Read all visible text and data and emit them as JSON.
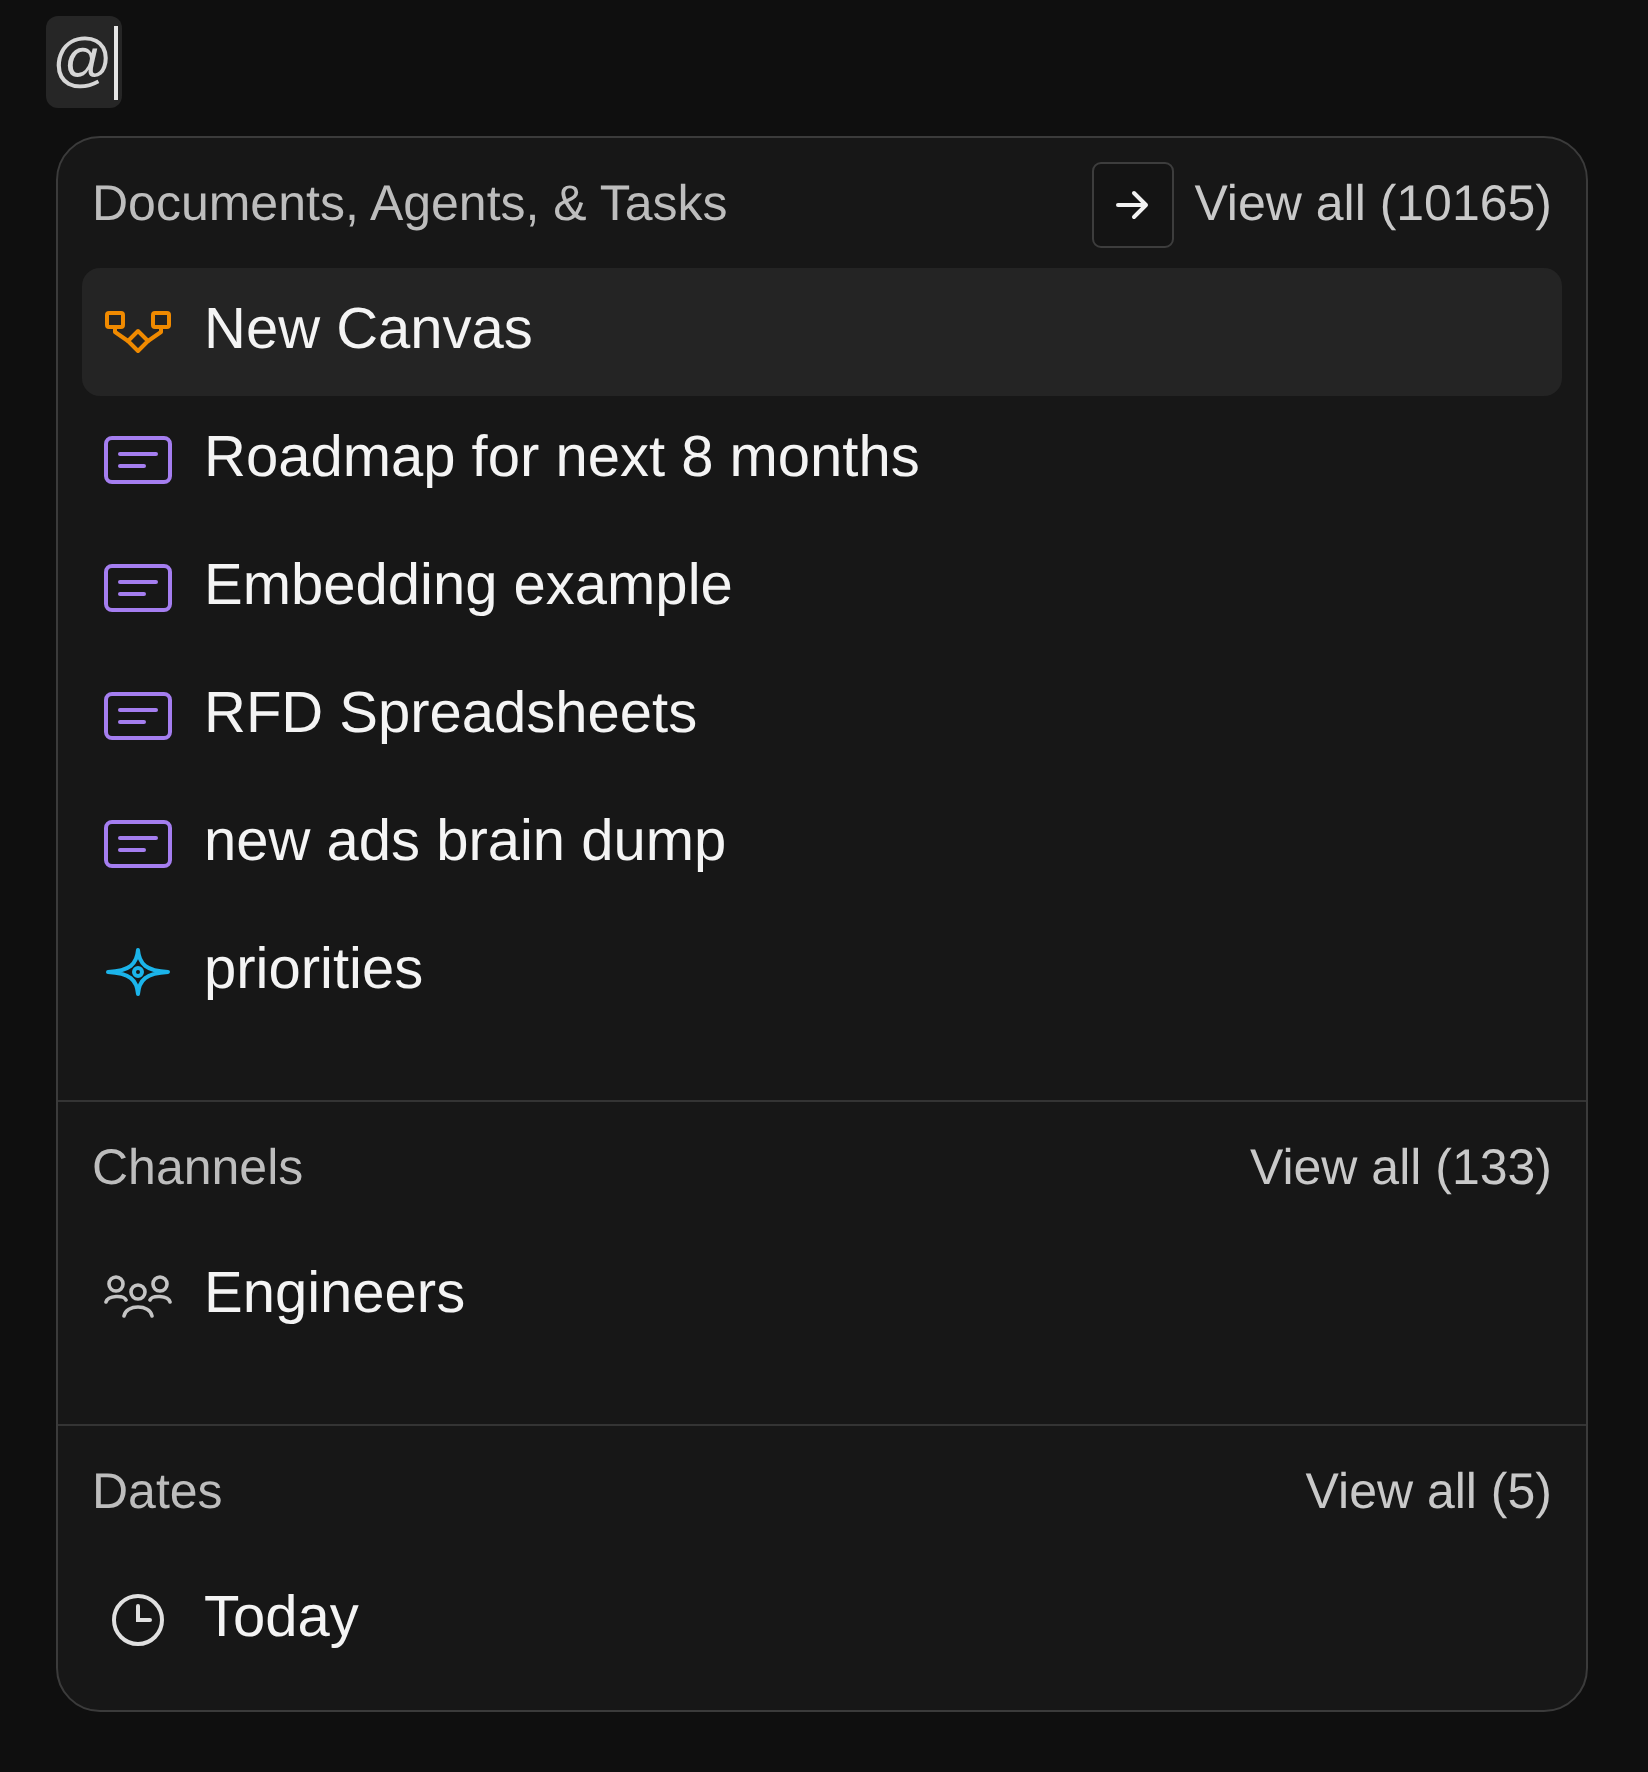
{
  "input": {
    "value": "@"
  },
  "sections": [
    {
      "title": "Documents, Agents, & Tasks",
      "view_all": "View all (10165)",
      "shortcut_hint": true,
      "items": [
        {
          "label": "New Canvas",
          "kind": "canvas",
          "selected": true
        },
        {
          "label": "Roadmap for next 8 months",
          "kind": "document",
          "selected": false
        },
        {
          "label": "Embedding example",
          "kind": "document",
          "selected": false
        },
        {
          "label": "RFD Spreadsheets",
          "kind": "document",
          "selected": false
        },
        {
          "label": "new ads brain dump",
          "kind": "document",
          "selected": false
        },
        {
          "label": "priorities",
          "kind": "agent",
          "selected": false
        }
      ]
    },
    {
      "title": "Channels",
      "view_all": "View all (133)",
      "shortcut_hint": false,
      "items": [
        {
          "label": "Engineers",
          "kind": "channel",
          "selected": false
        }
      ]
    },
    {
      "title": "Dates",
      "view_all": "View all (5)",
      "shortcut_hint": false,
      "items": [
        {
          "label": "Today",
          "kind": "date",
          "selected": false
        }
      ]
    }
  ]
}
